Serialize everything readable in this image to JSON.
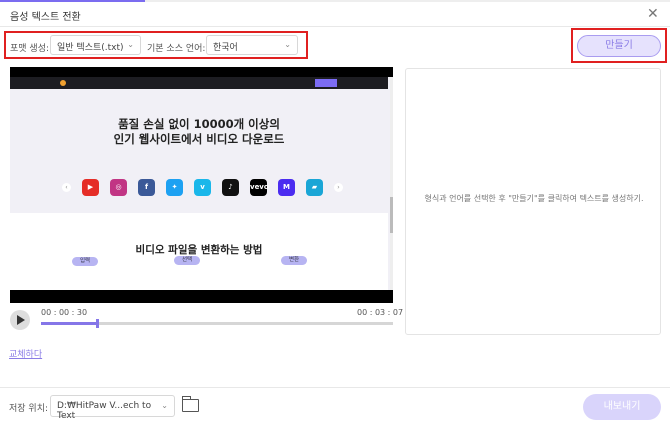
{
  "window": {
    "title": "음성 텍스트 전환",
    "close_icon": "close-icon"
  },
  "toolbar": {
    "format_label": "포맷 생성:",
    "format_value": "일반 텍스트(.txt)",
    "language_label": "기본 소스 언어:",
    "language_value": "한국어",
    "make_button": "만들기"
  },
  "preview": {
    "headline_1": "품질 손실 없이 10000개 이상의",
    "headline_2": "인기 웹사이트에서 비디오 다운로드",
    "section_title": "비디오 파일을 변환하는 방법",
    "steps": [
      "입력",
      "선택",
      "변환"
    ],
    "site_icons": [
      {
        "name": "youtube",
        "color": "#e52d27"
      },
      {
        "name": "instagram",
        "color": "#c13584"
      },
      {
        "name": "facebook",
        "color": "#3b5998"
      },
      {
        "name": "twitter",
        "color": "#1da1f2"
      },
      {
        "name": "vimeo",
        "color": "#1ab7ea"
      },
      {
        "name": "tiktok",
        "color": "#111111"
      },
      {
        "name": "vevo",
        "color": "#000000"
      },
      {
        "name": "dailymotion",
        "color": "#4b2cf0"
      },
      {
        "name": "other",
        "color": "#1aa6d6"
      }
    ]
  },
  "player": {
    "current_time": "00 : 00 : 30",
    "total_time": "00 : 03 : 07",
    "progress": 0.16
  },
  "result_panel": {
    "hint": "형식과 언어를 선택한 후 \"만들기\"를 클릭하여 텍스트를 생성하기."
  },
  "replace_link": "교체하다",
  "footer": {
    "save_label": "저장 위치:",
    "save_path": "D:₩HitPaw V...ech to Text",
    "export_button": "내보내기"
  },
  "colors": {
    "accent": "#8576e8",
    "highlight": "#e02020"
  }
}
